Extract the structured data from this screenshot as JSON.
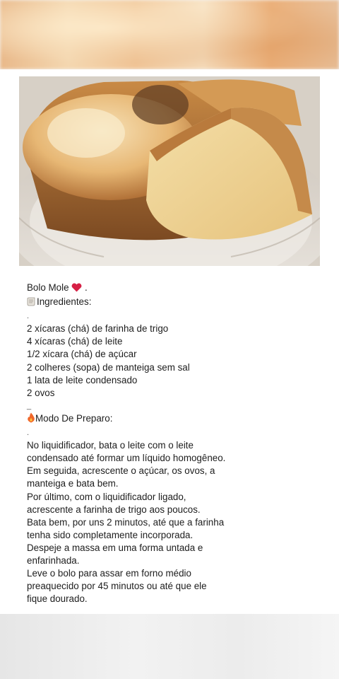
{
  "recipe": {
    "title": "Bolo Mole",
    "title_suffix": ".",
    "ingredients_heading": "Ingredientes:",
    "ingredients": [
      "2 xícaras (chá) de farinha de trigo",
      "4 xícaras (chá) de leite",
      "1/2 xícara (chá) de açúcar",
      "2 colheres (sopa) de manteiga sem sal",
      "1 lata de leite condensado",
      "2 ovos"
    ],
    "method_heading": "Modo De Preparo:",
    "method_lines": [
      "No liquidificador, bata o leite com o leite",
      "condensado até formar um líquido homogêneo.",
      "Em seguida, acrescente o açúcar, os ovos, a",
      "manteiga e bata bem.",
      "Por último, com o liquidificador ligado,",
      "acrescente a farinha de trigo aos poucos.",
      "Bata bem, por uns 2 minutos, até que a farinha",
      "tenha sido completamente incorporada.",
      "Despeje a massa em uma forma untada e",
      "enfarinhada.",
      "Leve o bolo para assar em forno médio",
      "preaquecido por 45 minutos ou até que ele",
      "fique dourado."
    ]
  },
  "icons": {
    "heart": "heart-icon",
    "scroll": "scroll-icon",
    "fire": "fire-icon"
  },
  "colors": {
    "heart": "#d62045",
    "fire": "#f0672a"
  }
}
